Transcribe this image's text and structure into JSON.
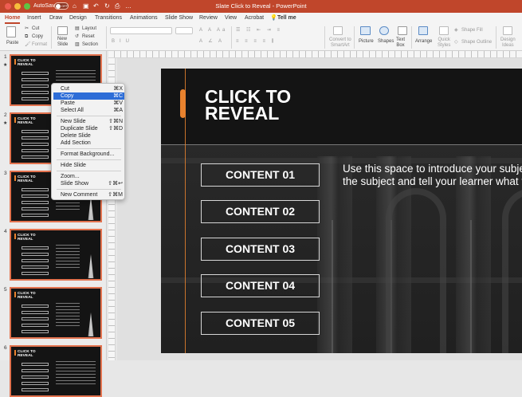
{
  "titlebar": {
    "autosave_label": "AutoSave",
    "autosave_state": "OFF",
    "document_title": "Slate Click to Reveal - PowerPoint",
    "icons": [
      "home-icon",
      "save-icon",
      "undo-icon",
      "redo-icon",
      "print-icon",
      "more-icon"
    ]
  },
  "tabs": [
    "Home",
    "Insert",
    "Draw",
    "Design",
    "Transitions",
    "Animations",
    "Slide Show",
    "Review",
    "View",
    "Acrobat"
  ],
  "tell_me": "Tell me",
  "ribbon": {
    "paste": "Paste",
    "cut": "Cut",
    "copy": "Copy",
    "format": "Format",
    "new_slide": "New\nSlide",
    "layout": "Layout",
    "reset": "Reset",
    "section": "Section",
    "convert_smartart": "Convert to\nSmartArt",
    "picture": "Picture",
    "shapes": "Shapes",
    "text_box": "Text\nBox",
    "arrange": "Arrange",
    "quick_styles": "Quick\nStyles",
    "shape_fill": "Shape Fill",
    "shape_outline": "Shape Outline",
    "design_ideas": "Design\nIdeas"
  },
  "thumbnails": [
    {
      "number": "1",
      "starred": true,
      "title": "CLICK TO\nREVEAL",
      "type": "intro"
    },
    {
      "number": "2",
      "starred": true,
      "title": "CLICK TO\nREVEAL",
      "type": "buttons"
    },
    {
      "number": "3",
      "starred": false,
      "title": "CLICK TO\nREVEAL",
      "type": "tower"
    },
    {
      "number": "4",
      "starred": false,
      "title": "CLICK TO\nREVEAL",
      "type": "tower"
    },
    {
      "number": "5",
      "starred": false,
      "title": "CLICK TO\nREVEAL",
      "type": "tower"
    },
    {
      "number": "6",
      "starred": false,
      "title": "CLICK TO\nREVEAL",
      "type": "buttons"
    }
  ],
  "thumb_star_glyph": "★",
  "context_menu": {
    "groups": [
      [
        {
          "label": "Cut",
          "shortcut": "⌘X"
        },
        {
          "label": "Copy",
          "shortcut": "⌘C",
          "highlighted": true
        },
        {
          "label": "Paste",
          "shortcut": "⌘V"
        },
        {
          "label": "Select All",
          "shortcut": "⌘A"
        }
      ],
      [
        {
          "label": "New Slide",
          "shortcut": "⇧⌘N"
        },
        {
          "label": "Duplicate Slide",
          "shortcut": "⇧⌘D"
        },
        {
          "label": "Delete Slide",
          "shortcut": ""
        },
        {
          "label": "Add Section",
          "shortcut": ""
        }
      ],
      [
        {
          "label": "Format Background...",
          "shortcut": ""
        }
      ],
      [
        {
          "label": "Hide Slide",
          "shortcut": ""
        }
      ],
      [
        {
          "label": "Zoom...",
          "shortcut": ""
        },
        {
          "label": "Slide Show",
          "shortcut": "⇧⌘↩"
        }
      ],
      [
        {
          "label": "New Comment",
          "shortcut": "⇧⌘M"
        }
      ]
    ]
  },
  "slide": {
    "title": "CLICK TO\nREVEAL",
    "buttons": [
      "CONTENT 01",
      "CONTENT 02",
      "CONTENT 03",
      "CONTENT 04",
      "CONTENT 05"
    ],
    "body": "Use this space to introduce your subject\nthe subject and tell your learner what to"
  },
  "colors": {
    "title_bar": "#c0462b",
    "accent_orange": "#e8822e",
    "thumb_border": "#e3734f",
    "menu_highlight": "#2d6dd7",
    "slide_bg": "#141414"
  }
}
